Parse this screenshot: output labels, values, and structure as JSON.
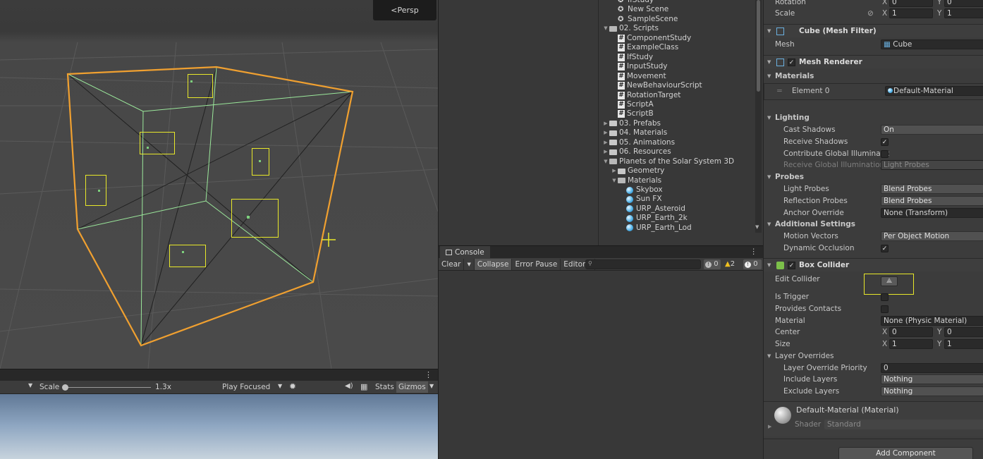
{
  "scene": {
    "persp_label": "<Persp"
  },
  "game_toolbar": {
    "scale_label": "Scale",
    "scale_value": "1.3x",
    "scale_fraction": 0.0,
    "play_focused": "Play Focused",
    "stats": "Stats",
    "gizmos": "Gizmos"
  },
  "project": {
    "rows": [
      {
        "label": "IfStudy",
        "icon": "scene",
        "indent": 2
      },
      {
        "label": "New Scene",
        "icon": "scene",
        "indent": 2
      },
      {
        "label": "SampleScene",
        "icon": "scene",
        "indent": 2
      },
      {
        "label": "02. Scripts",
        "icon": "folder-open",
        "indent": 1,
        "expanded": true
      },
      {
        "label": "ComponentStudy",
        "icon": "script",
        "indent": 2
      },
      {
        "label": "ExampleClass",
        "icon": "script",
        "indent": 2
      },
      {
        "label": "IfStudy",
        "icon": "script",
        "indent": 2
      },
      {
        "label": "InputStudy",
        "icon": "script",
        "indent": 2
      },
      {
        "label": "Movement",
        "icon": "script",
        "indent": 2
      },
      {
        "label": "NewBehaviourScript",
        "icon": "script",
        "indent": 2
      },
      {
        "label": "RotationTarget",
        "icon": "script",
        "indent": 2
      },
      {
        "label": "ScriptA",
        "icon": "script",
        "indent": 2
      },
      {
        "label": "ScriptB",
        "icon": "script",
        "indent": 2
      },
      {
        "label": "03. Prefabs",
        "icon": "folder",
        "indent": 1
      },
      {
        "label": "04. Materials",
        "icon": "folder",
        "indent": 1
      },
      {
        "label": "05. Animations",
        "icon": "folder",
        "indent": 1
      },
      {
        "label": "06. Resources",
        "icon": "folder",
        "indent": 1
      },
      {
        "label": "Planets of the Solar System 3D",
        "icon": "folder-open",
        "indent": 1,
        "expanded": true
      },
      {
        "label": "Geometry",
        "icon": "folder",
        "indent": 2
      },
      {
        "label": "Materials",
        "icon": "folder-open",
        "indent": 2,
        "expanded": true
      },
      {
        "label": "Skybox",
        "icon": "material",
        "indent": 3
      },
      {
        "label": "Sun FX",
        "icon": "material",
        "indent": 3
      },
      {
        "label": "URP_Asteroid",
        "icon": "material",
        "indent": 3
      },
      {
        "label": "URP_Earth_2k",
        "icon": "material",
        "indent": 3
      },
      {
        "label": "URP_Earth_Lod",
        "icon": "material",
        "indent": 3
      }
    ]
  },
  "console": {
    "tab": "Console",
    "clear": "Clear",
    "collapse": "Collapse",
    "error_pause": "Error Pause",
    "editor": "Editor",
    "count_info": "0",
    "count_warn": "2",
    "count_error": "0"
  },
  "inspector": {
    "rotation_label": "Rotation",
    "rotation_x": "0",
    "rotation_y": "0",
    "scale_label": "Scale",
    "scale_x": "1",
    "scale_y": "1",
    "mesh_filter_title": "Cube (Mesh Filter)",
    "mesh_label": "Mesh",
    "mesh_value": "Cube",
    "mesh_renderer_title": "Mesh Renderer",
    "materials_section": "Materials",
    "element0_label": "Element 0",
    "element0_value": "Default-Material",
    "lighting_section": "Lighting",
    "cast_shadows_label": "Cast Shadows",
    "cast_shadows_value": "On",
    "receive_shadows_label": "Receive Shadows",
    "contribute_gi_label": "Contribute Global Illuminatic",
    "receive_gi_label": "Receive Global Illumination",
    "receive_gi_value": "Light Probes",
    "probes_section": "Probes",
    "light_probes_label": "Light Probes",
    "light_probes_value": "Blend Probes",
    "reflection_probes_label": "Reflection Probes",
    "reflection_probes_value": "Blend Probes",
    "anchor_override_label": "Anchor Override",
    "anchor_override_value": "None (Transform)",
    "additional_section": "Additional Settings",
    "motion_vectors_label": "Motion Vectors",
    "motion_vectors_value": "Per Object Motion",
    "dynamic_occlusion_label": "Dynamic Occlusion",
    "box_collider_title": "Box Collider",
    "edit_collider_label": "Edit Collider",
    "is_trigger_label": "Is Trigger",
    "provides_contacts_label": "Provides Contacts",
    "material_label": "Material",
    "material_value": "None (Physic Material)",
    "center_label": "Center",
    "center_x": "0",
    "center_y": "0",
    "size_label": "Size",
    "size_x": "1",
    "size_y": "1",
    "layer_overrides_section": "Layer Overrides",
    "layer_priority_label": "Layer Override Priority",
    "layer_priority_value": "0",
    "include_layers_label": "Include Layers",
    "include_layers_value": "Nothing",
    "exclude_layers_label": "Exclude Layers",
    "exclude_layers_value": "Nothing",
    "material_preview_title": "Default-Material (Material)",
    "shader_label": "Shader",
    "shader_value": "Standard",
    "add_component": "Add Component"
  },
  "colors": {
    "highlight": "#e8e82a",
    "selection_outline": "#f0a030",
    "collider_green": "#9be89b"
  }
}
